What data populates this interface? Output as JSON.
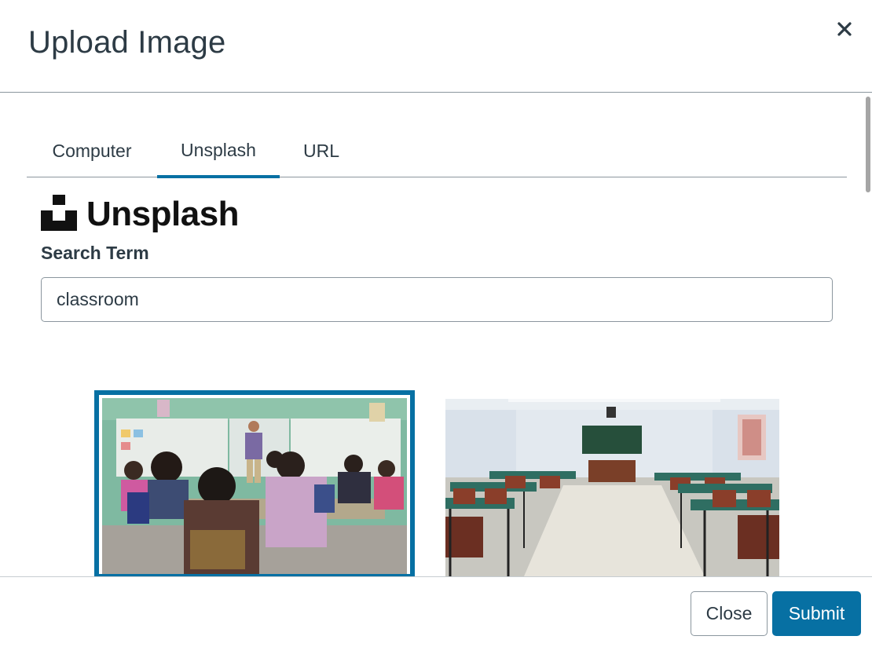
{
  "dialog": {
    "title": "Upload Image",
    "close_icon": "close-icon"
  },
  "tabs": [
    {
      "label": "Computer",
      "active": false
    },
    {
      "label": "Unsplash",
      "active": true
    },
    {
      "label": "URL",
      "active": false
    }
  ],
  "unsplash": {
    "logo_icon": "unsplash-logo-icon",
    "logo_text": "Unsplash",
    "search_label": "Search Term",
    "search_value": "classroom"
  },
  "results": [
    {
      "description": "students-in-classroom-with-teacher",
      "selected": true
    },
    {
      "description": "empty-classroom-with-desks",
      "selected": false
    }
  ],
  "footer": {
    "close_label": "Close",
    "submit_label": "Submit"
  },
  "colors": {
    "accent": "#0770a3",
    "text": "#2d3b45",
    "border": "#8b969e"
  }
}
